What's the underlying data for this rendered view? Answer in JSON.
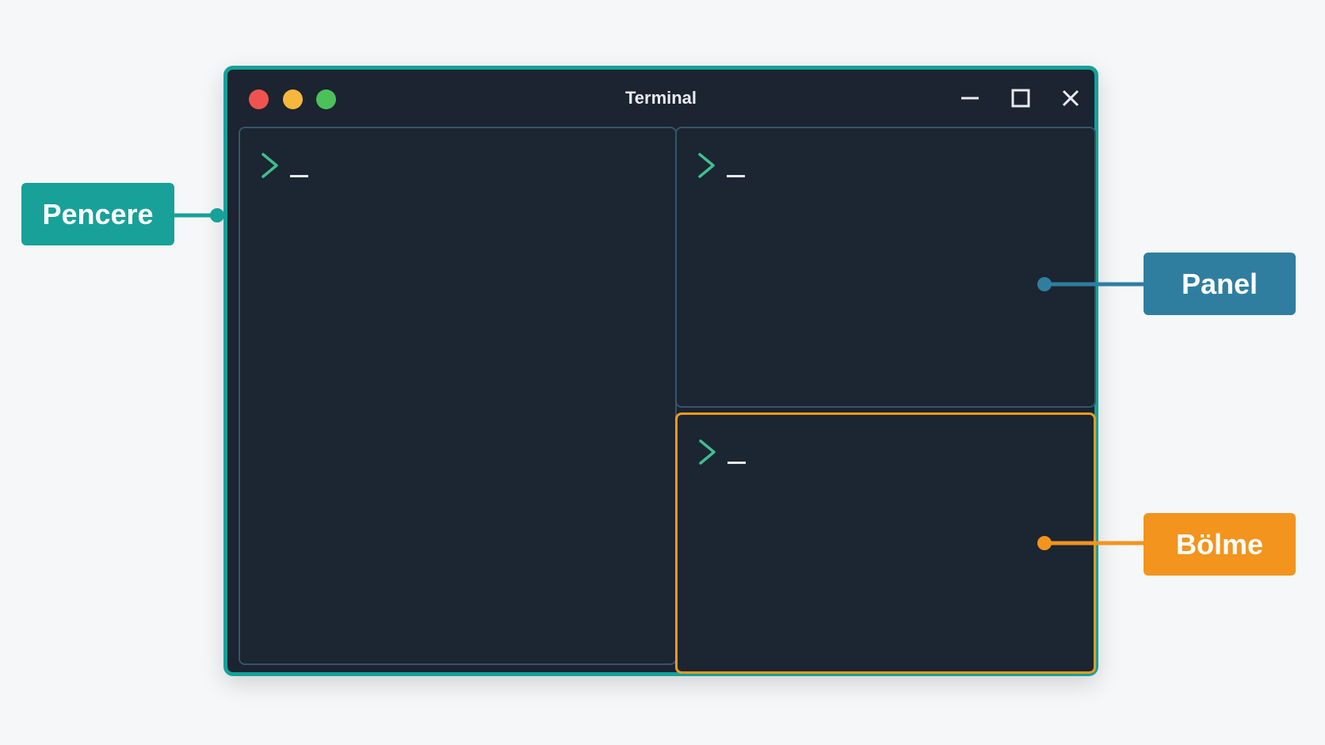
{
  "window": {
    "title": "Terminal",
    "buttons": {
      "close_dot": "close-dot",
      "minimize_dot": "minimize-dot",
      "zoom_dot": "zoom-dot"
    },
    "controls": [
      "minimize-icon",
      "maximize-icon",
      "close-icon"
    ]
  },
  "panes": [
    {
      "id": "left",
      "prompt_icon": "chevron-right-icon",
      "cursor": "_"
    },
    {
      "id": "top-right",
      "prompt_icon": "chevron-right-icon",
      "cursor": "_"
    },
    {
      "id": "bottom-right",
      "prompt_icon": "chevron-right-icon",
      "cursor": "_"
    }
  ],
  "labels": {
    "window_label": "Pencere",
    "panel_label": "Panel",
    "split_label": "Bölme"
  },
  "colors": {
    "window_border": "#14a19a",
    "panel_blue": "#2f7ea0",
    "split_orange": "#f2941d",
    "prompt_green": "#3fbf8f",
    "terminal_bg": "#1b2430"
  }
}
